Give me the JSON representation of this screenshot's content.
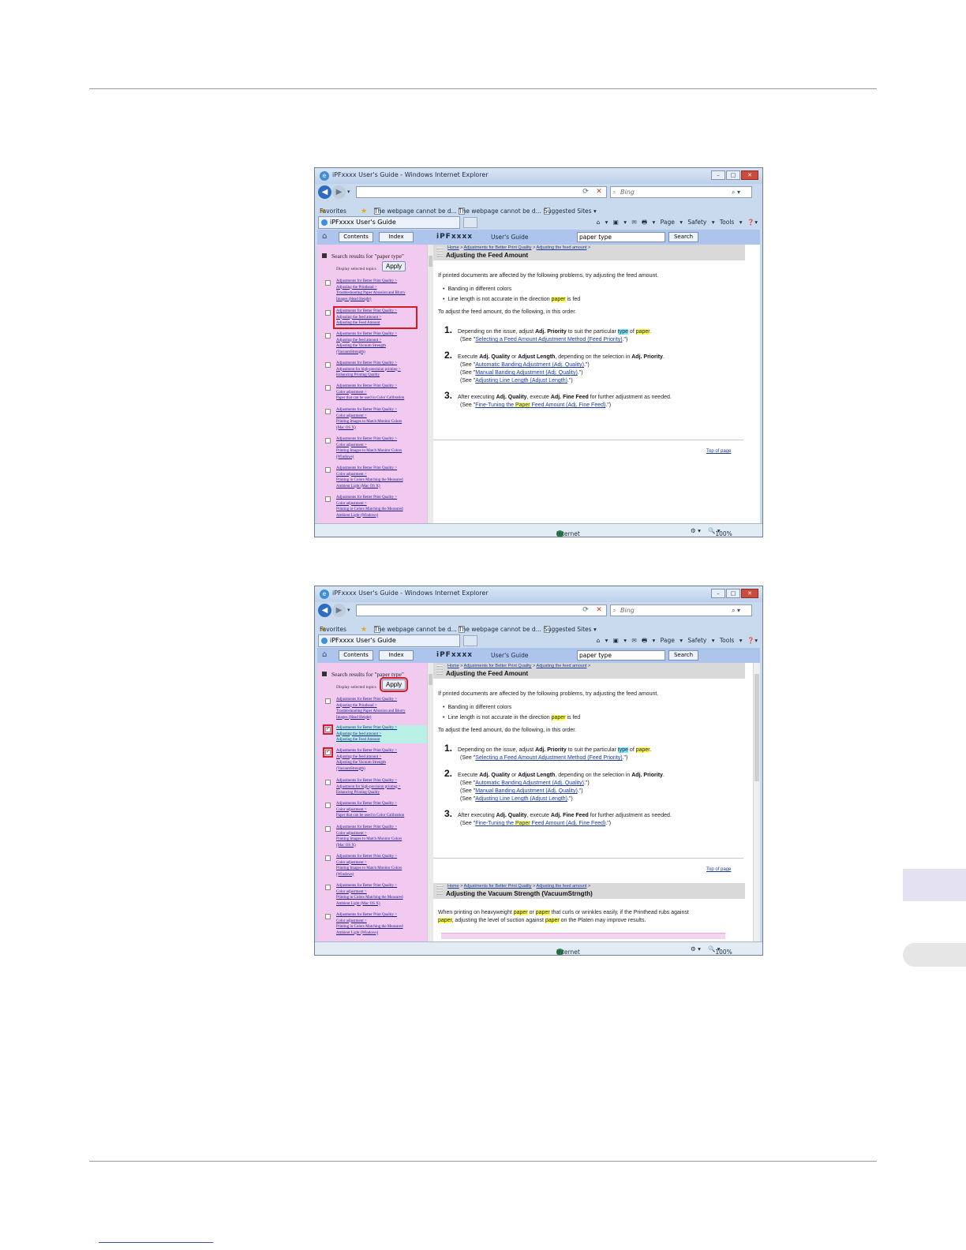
{
  "browser": {
    "window_title": "iPFxxxx  User's Guide - Windows Internet Explorer",
    "window_buttons": [
      "–",
      "□",
      "✕"
    ],
    "address_value": "",
    "search_placeholder": "Bing",
    "favorites_label": "Favorites",
    "fav_items": [
      "The webpage cannot be d...",
      "The webpage cannot be d...",
      "Suggested Sites ▾"
    ],
    "tab_label": "iPFxxxx User's Guide",
    "command_bar": "Page ▾  Safety ▾  Tools ▾",
    "status_zone": "Internet",
    "zoom": "100%"
  },
  "guide": {
    "contents_button": "Contents",
    "index_button": "Index",
    "brand": "iPFxxxx",
    "title": "User's Guide",
    "search_value": "paper type",
    "search_button": "Search"
  },
  "left_pane": {
    "results_heading": "Search results for \"paper type\"",
    "display_selected": "Display selected topics",
    "apply_label": "Apply",
    "items": [
      [
        "Adjustments for Better Print Quality >",
        "Adjusting the Printhead >",
        "Troubleshooting Paper Abrasion and Blurry",
        "Images (Head Height)"
      ],
      [
        "Adjustments for Better Print Quality >",
        "Adjusting the feed amount >",
        "Adjusting the Feed Amount"
      ],
      [
        "Adjustments for Better Print Quality >",
        "Adjusting the feed amount >",
        "Adjusting the Vacuum Strength",
        "(VacuumStrength)"
      ],
      [
        "Adjustments for Better Print Quality >",
        "Adjustment for high-precision printing >",
        "Enhancing Printing Quality"
      ],
      [
        "Adjustments for Better Print Quality >",
        "Color adjustment >",
        "Paper that can be used in Color Calibration"
      ],
      [
        "Adjustments for Better Print Quality >",
        "Color adjustment >",
        "Printing Images to Match Monitor Colors",
        "(Mac OS X)"
      ],
      [
        "Adjustments for Better Print Quality >",
        "Color adjustment >",
        "Printing Images to Match Monitor Colors",
        "(Windows)"
      ],
      [
        "Adjustments for Better Print Quality >",
        "Color adjustment >",
        "Printing in Colors Matching the Measured",
        "Ambient Light (Mac OS X)"
      ],
      [
        "Adjustments for Better Print Quality >",
        "Color adjustment >",
        "Printing in Colors Matching the Measured",
        "Ambient Light (Windows)"
      ]
    ]
  },
  "article": {
    "breadcrumb_home": "Home",
    "breadcrumb_sep": ">",
    "breadcrumb_section": "Adjustments for Better Print Quality",
    "breadcrumb_sub": "Adjusting the feed amount",
    "heading": "Adjusting the Feed Amount",
    "intro": "If printed documents are affected by the following problems, try adjusting the feed amount.",
    "bullet1": "Banding in different colors",
    "bullet2_a": "Line length is not accurate in the direction ",
    "bullet2_hl": "paper",
    "bullet2_b": " is fed",
    "order": "To adjust the feed amount, do the following, in this order.",
    "step1_num": "1.",
    "step1_a": "Depending on the issue, adjust ",
    "step1_b": "Adj. Priority",
    "step1_c": " to suit the particular ",
    "step1_type": "type",
    "step1_of": " of ",
    "step1_paper": "paper",
    "step1_end": ".",
    "see_prefix": "(See \"",
    "see_suffix": ".\")",
    "step1_link": "Selecting a Feed Amount Adjustment Method (Feed Priority)",
    "step2_num": "2.",
    "step2_a": "Execute ",
    "step2_b": "Adj. Quality",
    "step2_c": " or ",
    "step2_d": "Adjust Length",
    "step2_e": ", depending on the selection in ",
    "step2_f": "Adj. Priority",
    "step2_g": ".",
    "step2_link1": "Automatic Banding Adjustment (Adj. Quality)",
    "step2_link2": "Manual Banding Adjustment (Adj. Quality)",
    "step2_link3": "Adjusting Line Length (Adjust Length)",
    "step3_num": "3.",
    "step3_a": "After executing ",
    "step3_b": "Adj. Quality",
    "step3_c": ", execute ",
    "step3_d": "Adj. Fine Feed",
    "step3_e": " for further adjustment as needed.",
    "step3_link_a": "Fine-Tuning the ",
    "step3_link_hl": "Paper",
    "step3_link_b": " Feed Amount (Adj. Fine Feed)",
    "top_of_page": "Top of page",
    "heading2": "Adjusting the Vacuum Strength (VacuumStrngth)",
    "vac_1a": "When printing on heavyweight ",
    "vac_paper": "paper",
    "vac_or": " or ",
    "vac_1b": " that curls or wrinkles easily, if the Printhead rubs against",
    "vac_2b": ", adjusting the level of suction against ",
    "vac_2c": " on the Platen may improve results."
  },
  "colors": {
    "left_pane_bg": "#f2c9ef",
    "highlight_yellow": "#ffff55",
    "highlight_cyan": "#7fe9ff",
    "callout_red": "#d21d24",
    "link_blue": "#1a3a9a"
  }
}
